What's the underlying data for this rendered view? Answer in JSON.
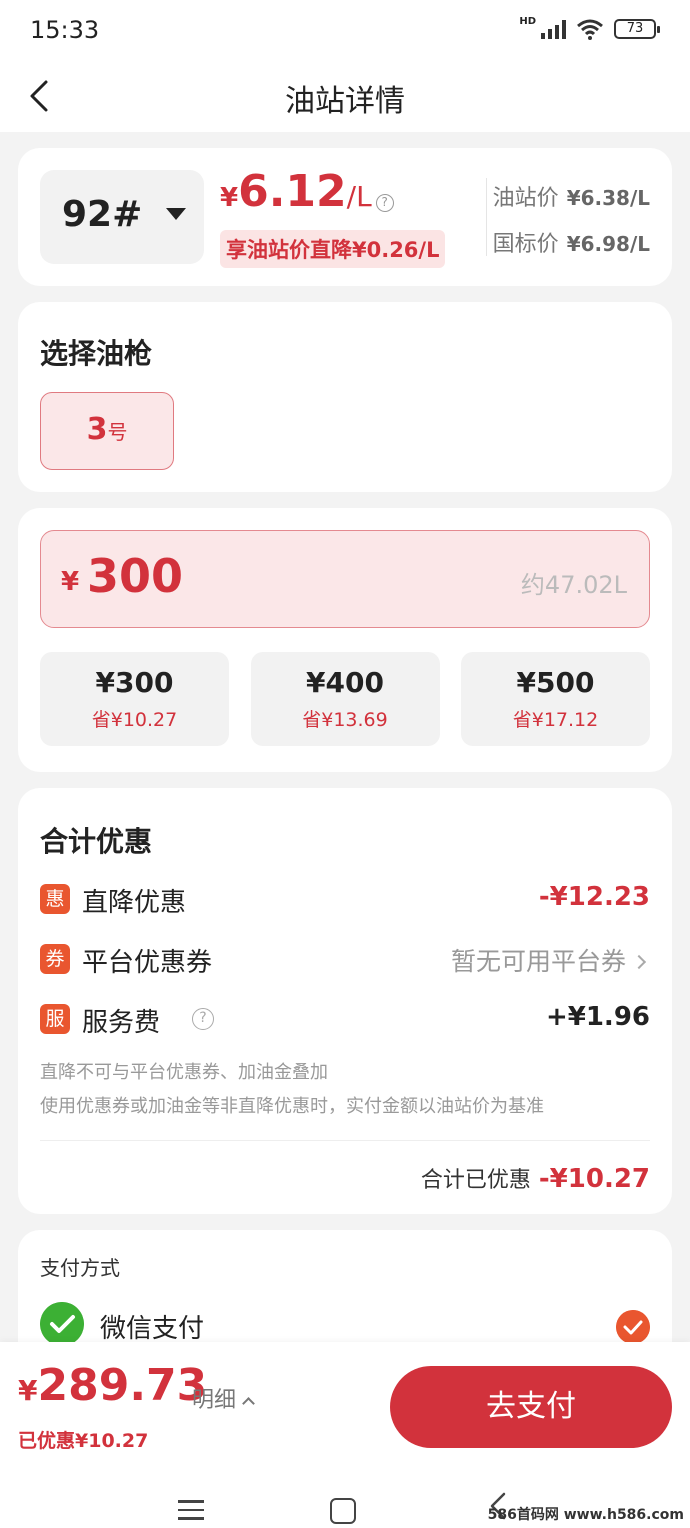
{
  "status_bar": {
    "time": "15:33",
    "network": "HD",
    "battery": "73"
  },
  "nav": {
    "title": "油站详情"
  },
  "price_card": {
    "grade": "92#",
    "currency": "¥",
    "price": "6.12",
    "unit": "/L",
    "discount_text": "享油站价直降¥0.26/L",
    "station_price_label": "油站价",
    "station_price_value": "¥6.38/L",
    "national_price_label": "国标价",
    "national_price_value": "¥6.98/L"
  },
  "nozzle": {
    "title": "选择油枪",
    "selected_number": "3",
    "selected_suffix": "号"
  },
  "amount": {
    "currency": "¥",
    "value": "300",
    "liters": "约47.02L",
    "options": [
      {
        "amount": "¥300",
        "save": "省¥10.27"
      },
      {
        "amount": "¥400",
        "save": "省¥13.69"
      },
      {
        "amount": "¥500",
        "save": "省¥17.12"
      }
    ]
  },
  "discount": {
    "title": "合计优惠",
    "direct_icon": "惠",
    "direct_label": "直降优惠",
    "direct_value": "-¥12.23",
    "coupon_icon": "券",
    "coupon_label": "平台优惠券",
    "coupon_value": "暂无可用平台券",
    "service_icon": "服",
    "service_label": "服务费",
    "service_value": "+¥1.96",
    "note1": "直降不可与平台优惠券、加油金叠加",
    "note2": "使用优惠券或加油金等非直降优惠时，实付金额以油站价为基准",
    "total_label": "合计已优惠",
    "total_value": "-¥10.27"
  },
  "payment": {
    "title": "支付方式",
    "method": "微信支付"
  },
  "bottom": {
    "currency": "¥",
    "total": "289.73",
    "detail_label": "明细",
    "saved": "已优惠¥10.27",
    "pay_label": "去支付"
  },
  "watermark": "586首码网 www.h586.com",
  "colors": {
    "accent": "#d2323c",
    "tag": "#e9562f",
    "wechat": "#3cb034"
  }
}
